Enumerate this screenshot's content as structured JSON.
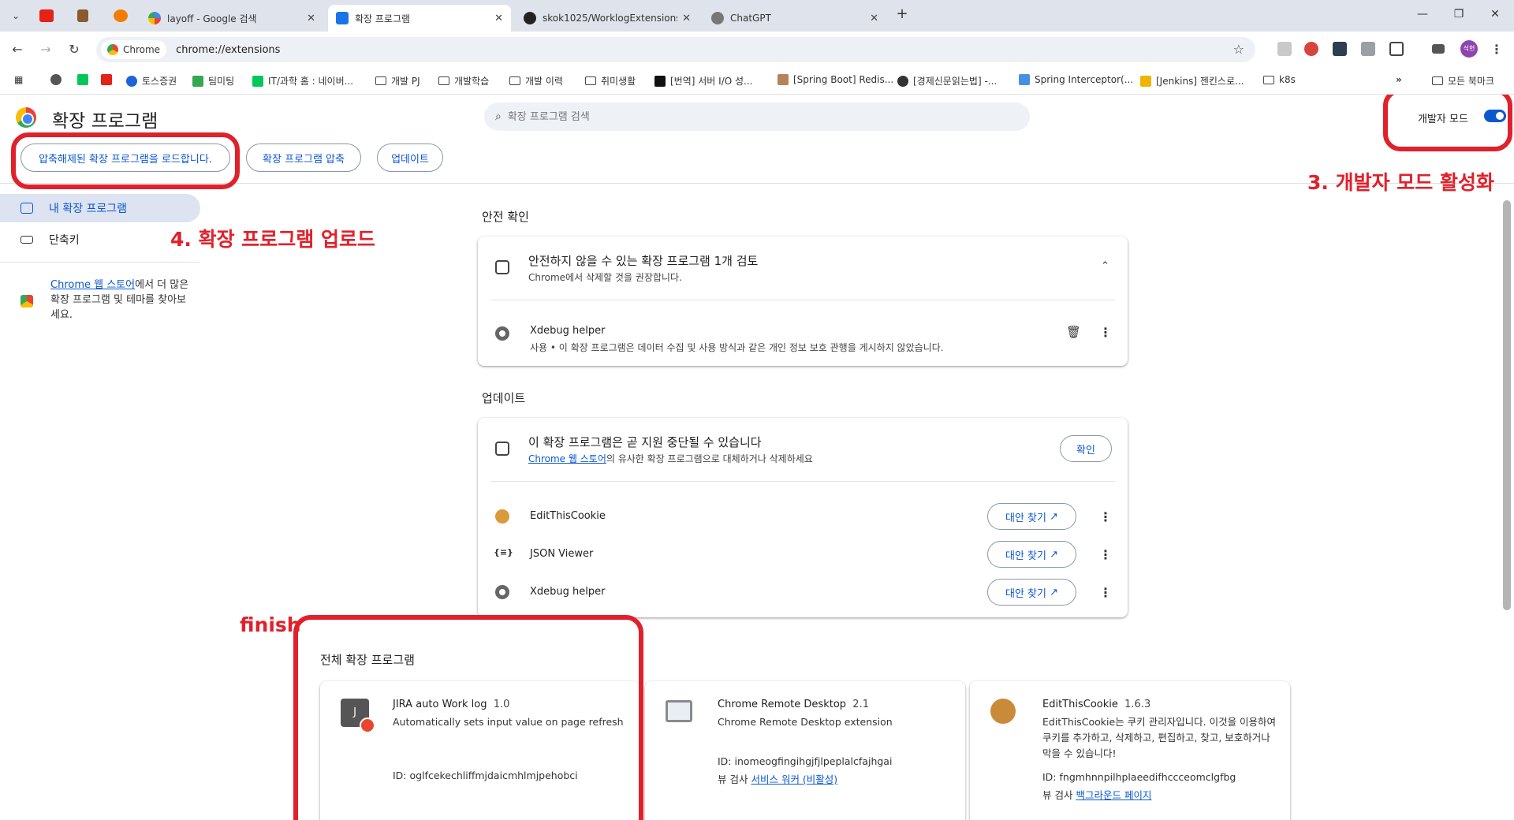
{
  "tabs": [
    {
      "title": "layoff - Google 검색"
    },
    {
      "title": "확장 프로그램"
    },
    {
      "title": "skok1025/WorklogExtensions"
    },
    {
      "title": "ChatGPT"
    }
  ],
  "toolbar": {
    "chip_label": "Chrome",
    "url": "chrome://extensions",
    "profile_initials": "석현"
  },
  "bookmarks": [
    "토스증권",
    "팀미팅",
    "IT/과학 홈 : 네이버...",
    "개발 PJ",
    "개발학습",
    "개발 이력",
    "취미생활",
    "[번역] 서버 I/O 성...",
    "[Spring Boot] Redis...",
    "[경제신문읽는법] -...",
    "Spring Interceptor(...",
    "[Jenkins] 젠킨스로...",
    "k8s",
    "모든 북마크"
  ],
  "header": {
    "title": "확장 프로그램",
    "search_placeholder": "확장 프로그램 검색",
    "dev_mode_label": "개발자 모드",
    "dev_mode_on": true
  },
  "dev_buttons": {
    "load_unpacked": "압축해제된 확장 프로그램을 로드합니다.",
    "pack": "확장 프로그램 압축",
    "update": "업데이트"
  },
  "sidebar": {
    "items": [
      {
        "label": "내 확장 프로그램"
      },
      {
        "label": "단축키"
      }
    ],
    "store_link": "Chrome 웹 스토어",
    "store_text_rest": "에서 더 많은 확장 프로그램 및 테마를 찾아보세요."
  },
  "safety": {
    "section_title": "안전 확인",
    "card_title": "안전하지 않을 수 있는 확장 프로그램 1개 검토",
    "card_subtitle": "Chrome에서 삭제할 것을 권장합니다.",
    "item_name": "Xdebug helper",
    "item_desc": "사용 • 이 확장 프로그램은 데이터 수집 및 사용 방식과 같은 개인 정보 보호 관행을 게시하지 않았습니다."
  },
  "updates": {
    "section_title": "업데이트",
    "card_title": "이 확장 프로그램은 곧 지원 중단될 수 있습니다",
    "card_link": "Chrome 웹 스토어",
    "card_subtitle_rest": "의 유사한 확장 프로그램으로 대체하거나 삭제하세요",
    "confirm_label": "확인",
    "items": [
      {
        "name": "EditThisCookie",
        "button": "대안 찾기"
      },
      {
        "name": "JSON Viewer",
        "button": "대안 찾기"
      },
      {
        "name": "Xdebug helper",
        "button": "대안 찾기"
      }
    ]
  },
  "all_extensions": {
    "section_title": "전체 확장 프로그램",
    "cards": [
      {
        "name": "JIRA auto Work log",
        "version": "1.0",
        "icon_letter": "J",
        "desc": "Automatically sets input value on page refresh",
        "id": "ID: oglfcekechliffmjdaicmhlmjpehobci"
      },
      {
        "name": "Chrome Remote Desktop",
        "version": "2.1",
        "desc": "Chrome Remote Desktop extension",
        "id": "ID: inomeogfingihgjfjlpeplalcfajhgai",
        "inspect_label": "뷰 검사",
        "inspect_link": "서비스 워커 (비활성)"
      },
      {
        "name": "EditThisCookie",
        "version": "1.6.3",
        "desc": "EditThisCookie는 쿠키 관리자입니다. 이것을 이용하여 쿠키를 추가하고, 삭제하고, 편집하고, 찾고, 보호하거나 막을 수 있습니다!",
        "id": "ID: fngmhnnpilhplaeedifhccceomclgfbg",
        "inspect_label": "뷰 검사",
        "inspect_link": "백그라운드 페이지"
      }
    ]
  },
  "annotations": {
    "step3": "3. 개발자 모드 활성화",
    "step4": "4. 확장 프로그램 업로드",
    "finish": "finish"
  },
  "colors": {
    "accent": "#0b57d0",
    "annotation_red": "#e0212b",
    "tabstrip_bg": "#dfe3ec"
  }
}
